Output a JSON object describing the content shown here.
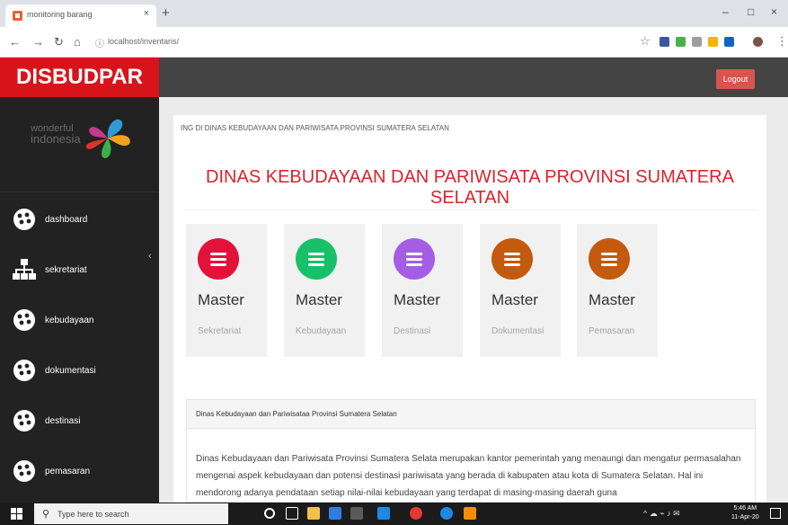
{
  "browser": {
    "tab_title": "monitoring barang",
    "tab_close": "×",
    "new_tab": "+",
    "url": "localhost/inventaris/",
    "window_controls": [
      "–",
      "□",
      "×"
    ]
  },
  "app": {
    "brand": "DISBUDPAR",
    "logo_text_1": "wonderful",
    "logo_text_2": "indonesia",
    "logout_label": "Logout"
  },
  "sidebar": {
    "items": [
      {
        "label": "dashboard",
        "icon": "gear-icon"
      },
      {
        "label": "sekretariat",
        "icon": "sitemap-icon"
      },
      {
        "label": "kebudayaan",
        "icon": "gear-icon"
      },
      {
        "label": "dokumentasi",
        "icon": "gear-icon"
      },
      {
        "label": "destinasi",
        "icon": "gear-icon"
      },
      {
        "label": "pemasaran",
        "icon": "gear-icon"
      }
    ]
  },
  "main": {
    "breadcrumb": "ING DI DINAS KEBUDAYAAN DAN PARIWISATA PROVINSI SUMATERA SELATAN",
    "title": "DINAS KEBUDAYAAN DAN PARIWISATA PROVINSI SUMATERA SELATAN",
    "cards": [
      {
        "title": "Master",
        "sub": "Sekretariat",
        "color": "#e2123b"
      },
      {
        "title": "Master",
        "sub": "Kebudayaan",
        "color": "#18c06a"
      },
      {
        "title": "Master",
        "sub": "Destinasi",
        "color": "#a45ee5"
      },
      {
        "title": "Master",
        "sub": "Dokumentasi",
        "color": "#c35a0d"
      },
      {
        "title": "Master",
        "sub": "Pemasaran",
        "color": "#c35a0d"
      }
    ],
    "info_heading": "Dinas Kebudayaan dan Pariwisataa Provinsi Sumatera Selatan",
    "info_body": "Dinas Kebudayaan dan Pariwisata Provinsi Sumatera Selata merupakan kantor pemerintah yang menaungi dan mengatur permasalahan mengenai aspek kebudayaan dan potensi destinasi pariwisata yang berada di kabupaten atau kota di Sumatera Selatan. Hal ini mendorong adanya pendataan setiap nilai-nilai kebudayaan yang terdapat di masing-masing daerah guna"
  },
  "taskbar": {
    "search_placeholder": "Type here to search",
    "time": "5:46 AM",
    "date": "11-Apr-20"
  },
  "colors": {
    "brand_red": "#d8141b",
    "sidebar_bg": "#222222",
    "topbar_bg": "#444444",
    "title_red": "#d9232d",
    "logout_bg": "#d9534f"
  }
}
